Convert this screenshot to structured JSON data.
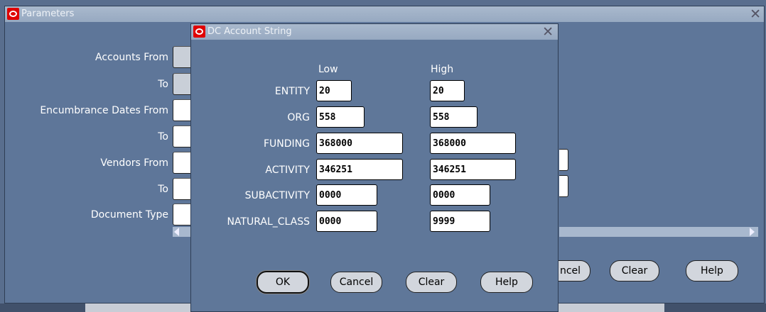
{
  "parameters": {
    "title": "Parameters",
    "labels": [
      "Accounts From",
      "To",
      "Encumbrance Dates From",
      "To",
      "Vendors From",
      "To",
      "Document Type"
    ],
    "buttons": {
      "cancel": "ncel",
      "clear": "Clear",
      "help": "Help"
    }
  },
  "dialog": {
    "title": "DC Account String",
    "low_header": "Low",
    "high_header": "High",
    "rows": [
      {
        "label": "ENTITY",
        "low": "20",
        "high": "20"
      },
      {
        "label": "ORG",
        "low": "558",
        "high": "558"
      },
      {
        "label": "FUNDING",
        "low": "368000",
        "high": "368000"
      },
      {
        "label": "ACTIVITY",
        "low": "346251",
        "high": "346251"
      },
      {
        "label": "SUBACTIVITY",
        "low": "0000",
        "high": "0000"
      },
      {
        "label": "NATURAL_CLASS",
        "low": "0000",
        "high": "9999"
      }
    ],
    "buttons": {
      "ok": "OK",
      "cancel": "Cancel",
      "clear": "Clear",
      "help": "Help"
    }
  },
  "icons": {
    "close": "close-icon",
    "oracle": "oracle-logo-icon"
  }
}
